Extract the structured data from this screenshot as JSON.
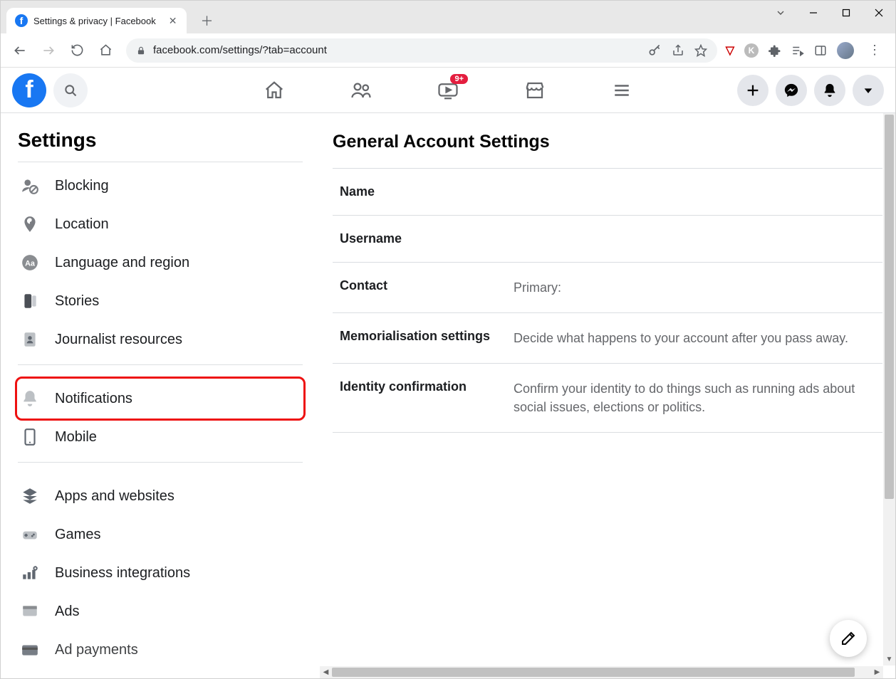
{
  "browser": {
    "tab_title": "Settings & privacy | Facebook",
    "url": "facebook.com/settings/?tab=account"
  },
  "fb_header": {
    "watch_badge": "9+"
  },
  "sidebar": {
    "title": "Settings",
    "items_g1": [
      {
        "icon": "block",
        "label": "Blocking"
      },
      {
        "icon": "location",
        "label": "Location"
      },
      {
        "icon": "language",
        "label": "Language and region"
      },
      {
        "icon": "stories",
        "label": "Stories"
      },
      {
        "icon": "journalist",
        "label": "Journalist resources"
      }
    ],
    "items_g2": [
      {
        "icon": "notifications",
        "label": "Notifications",
        "highlight": true
      },
      {
        "icon": "mobile",
        "label": "Mobile"
      }
    ],
    "items_g3": [
      {
        "icon": "apps",
        "label": "Apps and websites"
      },
      {
        "icon": "games",
        "label": "Games"
      },
      {
        "icon": "business",
        "label": "Business integrations"
      },
      {
        "icon": "ads",
        "label": "Ads"
      },
      {
        "icon": "adpay",
        "label": "Ad payments",
        "truncated": true
      }
    ]
  },
  "main": {
    "heading": "General Account Settings",
    "rows": [
      {
        "label": "Name",
        "value": ""
      },
      {
        "label": "Username",
        "value": ""
      },
      {
        "label": "Contact",
        "value": "Primary:"
      },
      {
        "label": "Memorialisation settings",
        "value": "Decide what happens to your account after you pass away."
      },
      {
        "label": "Identity confirmation",
        "value": "Confirm your identity to do things such as running ads about social issues, elections or politics."
      }
    ]
  }
}
